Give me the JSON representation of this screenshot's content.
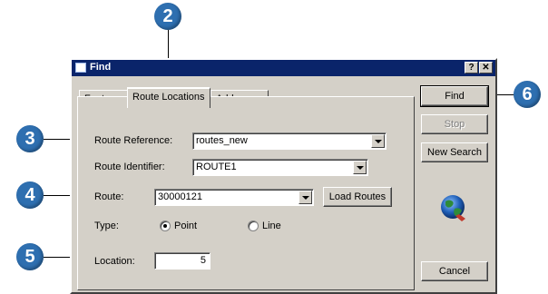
{
  "window": {
    "title": "Find",
    "help_btn": "?",
    "close_btn": "✕"
  },
  "tabs": [
    {
      "label": "Features",
      "active": false
    },
    {
      "label": "Route Locations",
      "active": true
    },
    {
      "label": "Addresses",
      "active": false
    }
  ],
  "form": {
    "route_reference": {
      "label": "Route Reference:",
      "value": "routes_new"
    },
    "route_identifier": {
      "label": "Route Identifier:",
      "value": "ROUTE1"
    },
    "route": {
      "label": "Route:",
      "value": "30000121"
    },
    "load_routes_label": "Load Routes",
    "type": {
      "label": "Type:",
      "options": [
        "Point",
        "Line"
      ],
      "selected": "Point"
    },
    "location": {
      "label": "Location:",
      "value": "5"
    }
  },
  "buttons": {
    "find": "Find",
    "stop": "Stop",
    "new_search": "New Search",
    "cancel": "Cancel"
  },
  "callouts": [
    "2",
    "3",
    "4",
    "5",
    "6"
  ],
  "colors": {
    "titlebar": "#0a246a",
    "dialog_bg": "#d4d0c8",
    "callout": "#2e6fb0"
  }
}
